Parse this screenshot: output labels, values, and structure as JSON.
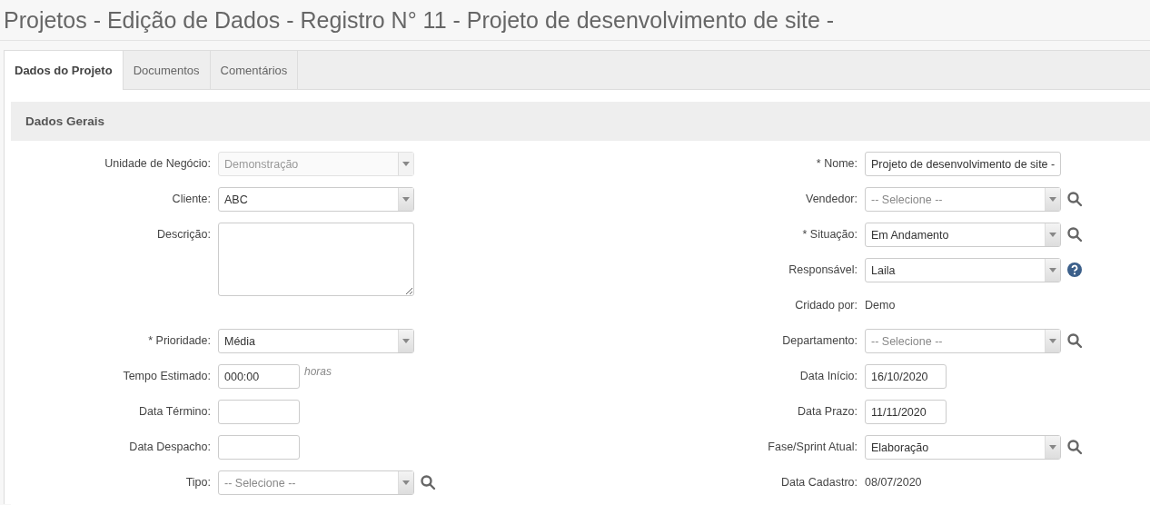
{
  "page_title": "Projetos - Edição de Dados - Registro N° 11 - Projeto de desenvolvimento de site -",
  "tabs": [
    {
      "label": "Dados do Projeto",
      "selected": true
    },
    {
      "label": "Documentos",
      "selected": false
    },
    {
      "label": "Comentários",
      "selected": false
    }
  ],
  "section": {
    "title": "Dados Gerais"
  },
  "left_fields": [
    {
      "label": "Unidade de Negócio:",
      "kind": "select",
      "value": "Demonstração",
      "disabled": true
    },
    {
      "label": "Cliente:",
      "kind": "select",
      "value": "ABC",
      "disabled": false
    },
    {
      "label": "Descrição:",
      "kind": "textarea"
    },
    {
      "label": "* Prioridade:",
      "kind": "select",
      "value": "Média",
      "disabled": false
    },
    {
      "label": "Tempo Estimado:",
      "kind": "short",
      "value": "000:00",
      "suffix": "horas"
    },
    {
      "label": "Data Término:",
      "kind": "short"
    },
    {
      "label": "Data Despacho:",
      "kind": "short"
    },
    {
      "label": "Tipo:",
      "kind": "select",
      "placeholder": "-- Selecione --",
      "disabled": false,
      "search_button": true
    }
  ],
  "right_fields": [
    {
      "label": "* Nome:",
      "kind": "text",
      "value": "Projeto de desenvolvimento de site -"
    },
    {
      "label": "Vendedor:",
      "kind": "select",
      "placeholder": "-- Selecione --",
      "disabled": false,
      "search_button": true
    },
    {
      "label": "* Situação:",
      "kind": "select",
      "value": "Em Andamento",
      "disabled": false,
      "search_button": true
    },
    {
      "label": "Responsável:",
      "kind": "select",
      "value": "Laila",
      "disabled": false,
      "help_button": true
    },
    {
      "label": "Cridado por:",
      "kind": "static",
      "value": "Demo"
    },
    {
      "label": "Departamento:",
      "kind": "select",
      "placeholder": "-- Selecione --",
      "disabled": false,
      "search_button": true
    },
    {
      "label": "Data Início:",
      "kind": "short",
      "value": "16/10/2020"
    },
    {
      "label": "Data Prazo:",
      "kind": "short",
      "value": "11/11/2020"
    },
    {
      "label": "Fase/Sprint Atual:",
      "kind": "select",
      "value": "Elaboração",
      "disabled": false,
      "search_button": true
    },
    {
      "label": "Data Cadastro:",
      "kind": "static",
      "value": "08/07/2020"
    }
  ]
}
